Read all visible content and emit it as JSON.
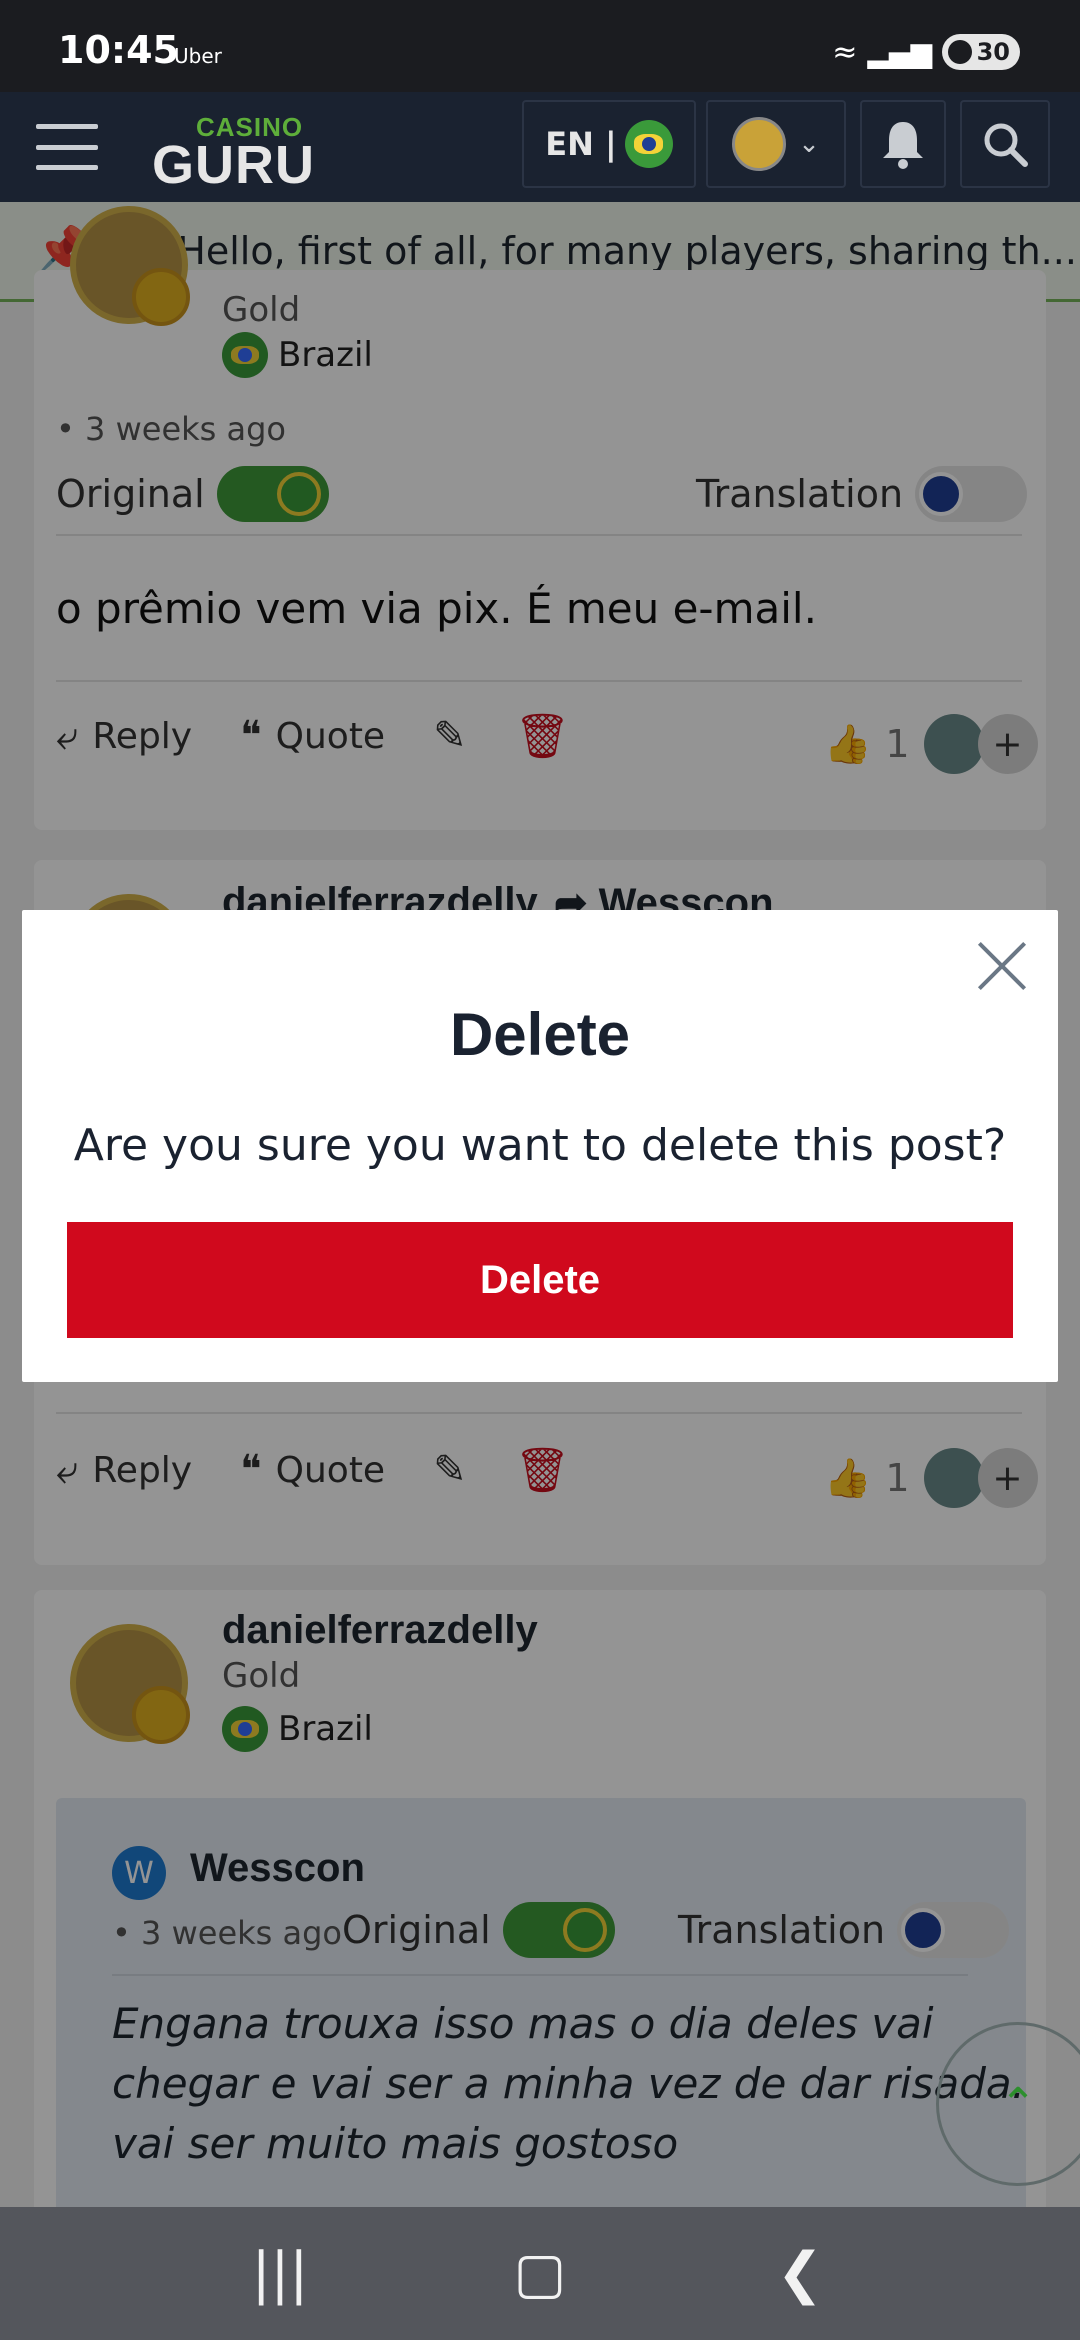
{
  "status_bar": {
    "time": "10:45",
    "app": "Uber",
    "battery": "30"
  },
  "header": {
    "logo_top": "CASINO",
    "logo_bottom": "GURU",
    "language": "EN |"
  },
  "pinned": {
    "text": "Hello, first of all, for many players, sharing th..."
  },
  "post1": {
    "rank": "Gold",
    "country": "Brazil",
    "time": "3 weeks ago",
    "original_label": "Original",
    "translation_label": "Translation",
    "body": "o prêmio vem via pix. É meu e-mail.",
    "reply": "Reply",
    "quote": "Quote",
    "likes": "1"
  },
  "post2": {
    "name": "danielferrazdelly",
    "reply_to": "Wesscon",
    "reply": "Reply",
    "quote": "Quote",
    "likes": "1"
  },
  "post3": {
    "name": "danielferrazdelly",
    "rank": "Gold",
    "country": "Brazil",
    "quote": {
      "badge": "W",
      "author": "Wesscon",
      "time": "3 weeks ago",
      "original_label": "Original",
      "translation_label": "Translation",
      "lines": [
        "Engana trouxa isso mas o dia deles vai",
        "chegar e vai ser a minha vez de dar risada.",
        "vai ser muito mais gostoso"
      ]
    }
  },
  "modal": {
    "title": "Delete",
    "message": "Are you sure you want to delete this post?",
    "button": "Delete"
  },
  "colors": {
    "danger": "#d0091d",
    "header_bg": "#1a2230",
    "brand_green": "#5eae3a"
  }
}
